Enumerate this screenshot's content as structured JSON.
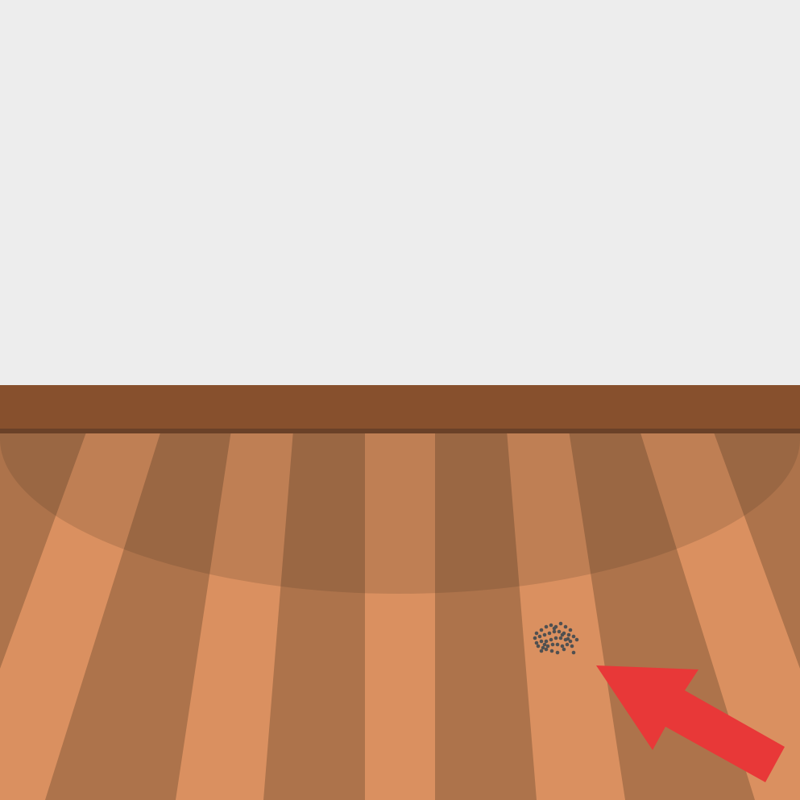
{
  "scene": {
    "wall_color": "#EDEDED",
    "baseboard_color": "#87502D",
    "baseboard_edge_color": "#6A4128",
    "floor_plank_light": "#DA9060",
    "floor_plank_dark": "#AD734B",
    "shadow_color": "#4A3020",
    "debris_color": "#505050",
    "arrow_color": "#E83838",
    "icons": [
      "dirt-debris-icon",
      "pointer-arrow-icon"
    ]
  }
}
